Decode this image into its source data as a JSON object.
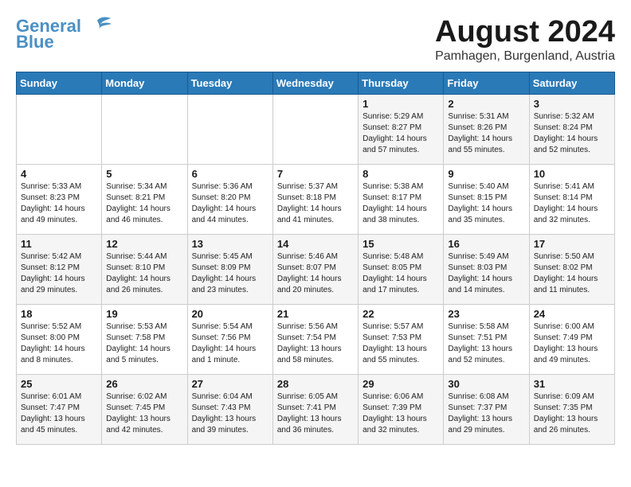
{
  "header": {
    "logo_line1": "General",
    "logo_line2": "Blue",
    "month": "August 2024",
    "location": "Pamhagen, Burgenland, Austria"
  },
  "weekdays": [
    "Sunday",
    "Monday",
    "Tuesday",
    "Wednesday",
    "Thursday",
    "Friday",
    "Saturday"
  ],
  "weeks": [
    [
      {
        "day": "",
        "info": ""
      },
      {
        "day": "",
        "info": ""
      },
      {
        "day": "",
        "info": ""
      },
      {
        "day": "",
        "info": ""
      },
      {
        "day": "1",
        "info": "Sunrise: 5:29 AM\nSunset: 8:27 PM\nDaylight: 14 hours\nand 57 minutes."
      },
      {
        "day": "2",
        "info": "Sunrise: 5:31 AM\nSunset: 8:26 PM\nDaylight: 14 hours\nand 55 minutes."
      },
      {
        "day": "3",
        "info": "Sunrise: 5:32 AM\nSunset: 8:24 PM\nDaylight: 14 hours\nand 52 minutes."
      }
    ],
    [
      {
        "day": "4",
        "info": "Sunrise: 5:33 AM\nSunset: 8:23 PM\nDaylight: 14 hours\nand 49 minutes."
      },
      {
        "day": "5",
        "info": "Sunrise: 5:34 AM\nSunset: 8:21 PM\nDaylight: 14 hours\nand 46 minutes."
      },
      {
        "day": "6",
        "info": "Sunrise: 5:36 AM\nSunset: 8:20 PM\nDaylight: 14 hours\nand 44 minutes."
      },
      {
        "day": "7",
        "info": "Sunrise: 5:37 AM\nSunset: 8:18 PM\nDaylight: 14 hours\nand 41 minutes."
      },
      {
        "day": "8",
        "info": "Sunrise: 5:38 AM\nSunset: 8:17 PM\nDaylight: 14 hours\nand 38 minutes."
      },
      {
        "day": "9",
        "info": "Sunrise: 5:40 AM\nSunset: 8:15 PM\nDaylight: 14 hours\nand 35 minutes."
      },
      {
        "day": "10",
        "info": "Sunrise: 5:41 AM\nSunset: 8:14 PM\nDaylight: 14 hours\nand 32 minutes."
      }
    ],
    [
      {
        "day": "11",
        "info": "Sunrise: 5:42 AM\nSunset: 8:12 PM\nDaylight: 14 hours\nand 29 minutes."
      },
      {
        "day": "12",
        "info": "Sunrise: 5:44 AM\nSunset: 8:10 PM\nDaylight: 14 hours\nand 26 minutes."
      },
      {
        "day": "13",
        "info": "Sunrise: 5:45 AM\nSunset: 8:09 PM\nDaylight: 14 hours\nand 23 minutes."
      },
      {
        "day": "14",
        "info": "Sunrise: 5:46 AM\nSunset: 8:07 PM\nDaylight: 14 hours\nand 20 minutes."
      },
      {
        "day": "15",
        "info": "Sunrise: 5:48 AM\nSunset: 8:05 PM\nDaylight: 14 hours\nand 17 minutes."
      },
      {
        "day": "16",
        "info": "Sunrise: 5:49 AM\nSunset: 8:03 PM\nDaylight: 14 hours\nand 14 minutes."
      },
      {
        "day": "17",
        "info": "Sunrise: 5:50 AM\nSunset: 8:02 PM\nDaylight: 14 hours\nand 11 minutes."
      }
    ],
    [
      {
        "day": "18",
        "info": "Sunrise: 5:52 AM\nSunset: 8:00 PM\nDaylight: 14 hours\nand 8 minutes."
      },
      {
        "day": "19",
        "info": "Sunrise: 5:53 AM\nSunset: 7:58 PM\nDaylight: 14 hours\nand 5 minutes."
      },
      {
        "day": "20",
        "info": "Sunrise: 5:54 AM\nSunset: 7:56 PM\nDaylight: 14 hours\nand 1 minute."
      },
      {
        "day": "21",
        "info": "Sunrise: 5:56 AM\nSunset: 7:54 PM\nDaylight: 13 hours\nand 58 minutes."
      },
      {
        "day": "22",
        "info": "Sunrise: 5:57 AM\nSunset: 7:53 PM\nDaylight: 13 hours\nand 55 minutes."
      },
      {
        "day": "23",
        "info": "Sunrise: 5:58 AM\nSunset: 7:51 PM\nDaylight: 13 hours\nand 52 minutes."
      },
      {
        "day": "24",
        "info": "Sunrise: 6:00 AM\nSunset: 7:49 PM\nDaylight: 13 hours\nand 49 minutes."
      }
    ],
    [
      {
        "day": "25",
        "info": "Sunrise: 6:01 AM\nSunset: 7:47 PM\nDaylight: 13 hours\nand 45 minutes."
      },
      {
        "day": "26",
        "info": "Sunrise: 6:02 AM\nSunset: 7:45 PM\nDaylight: 13 hours\nand 42 minutes."
      },
      {
        "day": "27",
        "info": "Sunrise: 6:04 AM\nSunset: 7:43 PM\nDaylight: 13 hours\nand 39 minutes."
      },
      {
        "day": "28",
        "info": "Sunrise: 6:05 AM\nSunset: 7:41 PM\nDaylight: 13 hours\nand 36 minutes."
      },
      {
        "day": "29",
        "info": "Sunrise: 6:06 AM\nSunset: 7:39 PM\nDaylight: 13 hours\nand 32 minutes."
      },
      {
        "day": "30",
        "info": "Sunrise: 6:08 AM\nSunset: 7:37 PM\nDaylight: 13 hours\nand 29 minutes."
      },
      {
        "day": "31",
        "info": "Sunrise: 6:09 AM\nSunset: 7:35 PM\nDaylight: 13 hours\nand 26 minutes."
      }
    ]
  ]
}
